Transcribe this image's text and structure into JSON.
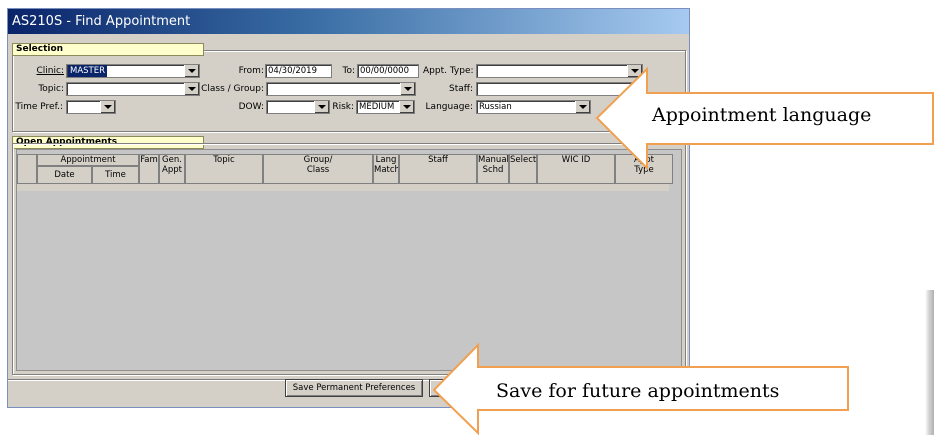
{
  "window": {
    "title": "AS210S - Find Appointment"
  },
  "selection": {
    "label": "Selection",
    "clinic": {
      "label": "Clinic:",
      "value": "MASTER"
    },
    "from": {
      "label": "From:",
      "value": "04/30/2019"
    },
    "to": {
      "label": "To:",
      "value": "00/00/0000"
    },
    "appt_type": {
      "label": "Appt. Type:",
      "value": ""
    },
    "topic": {
      "label": "Topic:",
      "value": ""
    },
    "class_group": {
      "label": "Class / Group:",
      "value": ""
    },
    "staff": {
      "label": "Staff:",
      "value": ""
    },
    "time_pref": {
      "label": "Time Pref.:",
      "value": ""
    },
    "dow": {
      "label": "DOW:",
      "value": ""
    },
    "risk": {
      "label": "Risk:",
      "value": "MEDIUM"
    },
    "language": {
      "label": "Language:",
      "value": "Russian"
    }
  },
  "open_appointments": {
    "label": "Open Appointments",
    "headers": {
      "appointment": "Appointment",
      "date": "Date",
      "time": "Time",
      "fam": "Fam",
      "gen_appt_1": "Gen.",
      "gen_appt_2": "Appt",
      "topic": "Topic",
      "group_1": "Group/",
      "group_2": "Class",
      "lang_1": "Lang",
      "lang_2": "Match",
      "staff": "Staff",
      "manual_1": "Manual",
      "manual_2": "Schd",
      "select": "Select",
      "wic_id": "WIC ID",
      "appt_type_1": "Appt",
      "appt_type_2": "Type"
    }
  },
  "footer": {
    "save_prefs": "Save Permanent Preferences"
  },
  "callouts": {
    "language": "Appointment language",
    "save": "Save for future appointments"
  }
}
